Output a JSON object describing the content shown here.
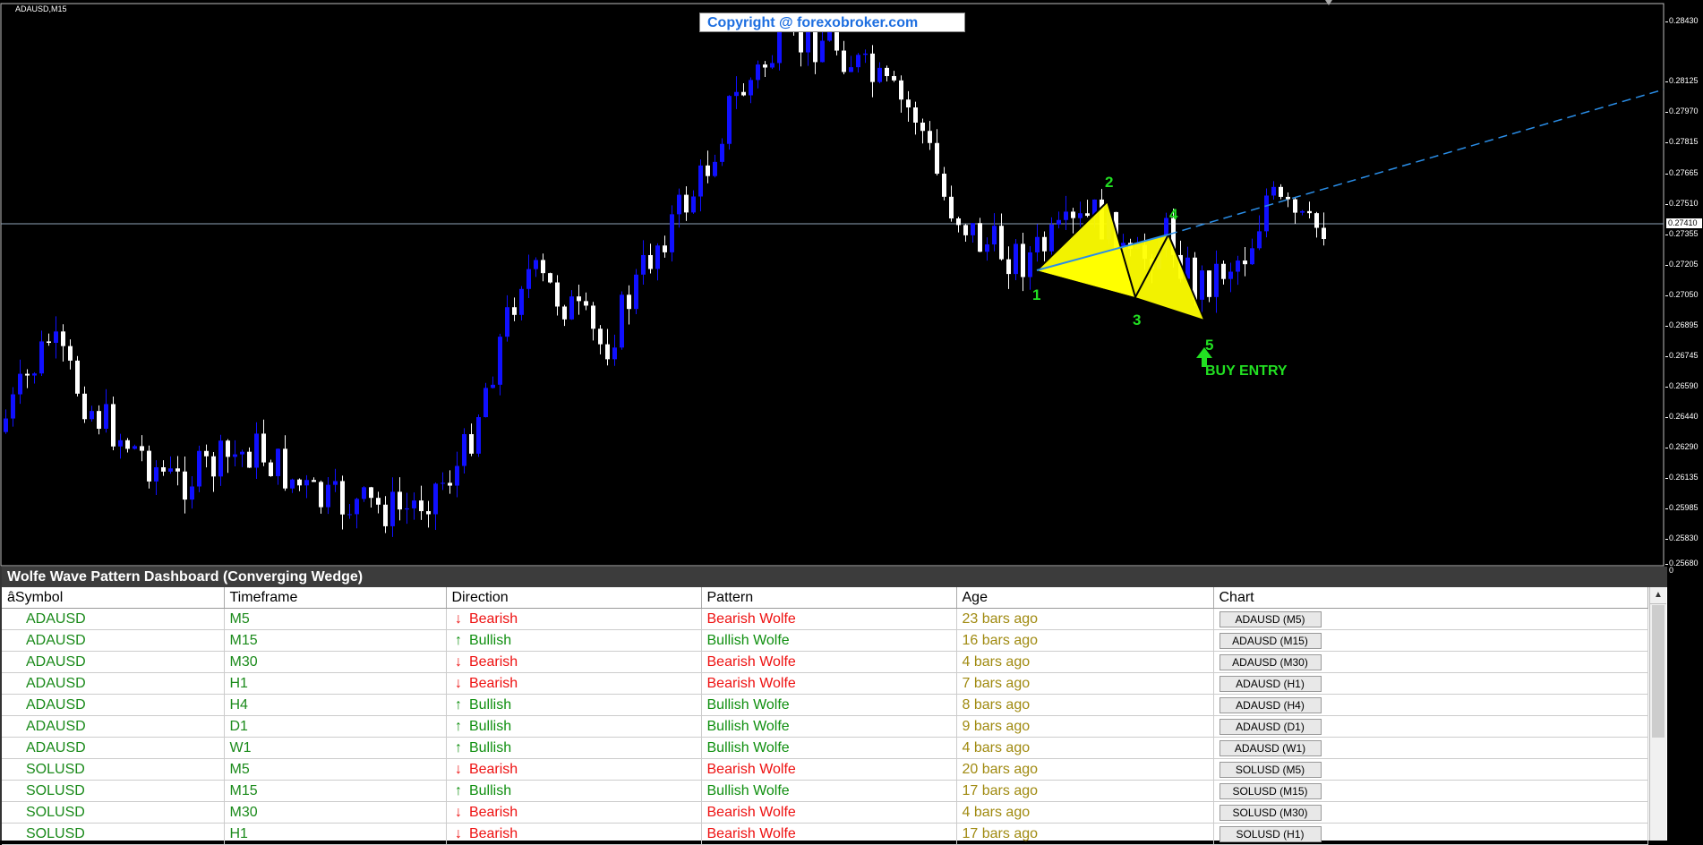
{
  "chart": {
    "symbol_label": "ADAUSD,M15",
    "copyright": "Copyright @ forexobroker.com",
    "current_price": "0.27410",
    "zero_label": "0",
    "price_ticks": [
      "0.28430",
      "0.28125",
      "0.27970",
      "0.27815",
      "0.27665",
      "0.27510",
      "0.27355",
      "0.27205",
      "0.27050",
      "0.26895",
      "0.26745",
      "0.26590",
      "0.26440",
      "0.26290",
      "0.26135",
      "0.25985",
      "0.25830",
      "0.25680"
    ],
    "wave_points": [
      "1",
      "2",
      "3",
      "4",
      "5"
    ],
    "buy_label": "BUY ENTRY",
    "colors": {
      "bull_candle": "#1010ff",
      "bear_candle": "#ffffff",
      "wedge": "#ffff00",
      "trendline": "#2a8ee8",
      "labels": "#22e022"
    }
  },
  "dashboard": {
    "title": "Wolfe Wave Pattern Dashboard (Converging Wedge)",
    "columns": [
      "âSymbol",
      "Timeframe",
      "Direction",
      "Pattern",
      "Age",
      "Chart"
    ],
    "rows": [
      {
        "symbol": "ADAUSD",
        "tf": "M5",
        "dir": "Bearish",
        "pattern": "Bearish Wolfe",
        "age": "23 bars ago",
        "chart": "ADAUSD (M5)"
      },
      {
        "symbol": "ADAUSD",
        "tf": "M15",
        "dir": "Bullish",
        "pattern": "Bullish Wolfe",
        "age": "16 bars ago",
        "chart": "ADAUSD (M15)"
      },
      {
        "symbol": "ADAUSD",
        "tf": "M30",
        "dir": "Bearish",
        "pattern": "Bearish Wolfe",
        "age": "4 bars ago",
        "chart": "ADAUSD (M30)"
      },
      {
        "symbol": "ADAUSD",
        "tf": "H1",
        "dir": "Bearish",
        "pattern": "Bearish Wolfe",
        "age": "7 bars ago",
        "chart": "ADAUSD (H1)"
      },
      {
        "symbol": "ADAUSD",
        "tf": "H4",
        "dir": "Bullish",
        "pattern": "Bullish Wolfe",
        "age": "8 bars ago",
        "chart": "ADAUSD (H4)"
      },
      {
        "symbol": "ADAUSD",
        "tf": "D1",
        "dir": "Bullish",
        "pattern": "Bullish Wolfe",
        "age": "9 bars ago",
        "chart": "ADAUSD (D1)"
      },
      {
        "symbol": "ADAUSD",
        "tf": "W1",
        "dir": "Bullish",
        "pattern": "Bullish Wolfe",
        "age": "4 bars ago",
        "chart": "ADAUSD (W1)"
      },
      {
        "symbol": "SOLUSD",
        "tf": "M5",
        "dir": "Bearish",
        "pattern": "Bearish Wolfe",
        "age": "20 bars ago",
        "chart": "SOLUSD (M5)"
      },
      {
        "symbol": "SOLUSD",
        "tf": "M15",
        "dir": "Bullish",
        "pattern": "Bullish Wolfe",
        "age": "17 bars ago",
        "chart": "SOLUSD (M15)"
      },
      {
        "symbol": "SOLUSD",
        "tf": "M30",
        "dir": "Bearish",
        "pattern": "Bearish Wolfe",
        "age": "4 bars ago",
        "chart": "SOLUSD (M30)"
      },
      {
        "symbol": "SOLUSD",
        "tf": "H1",
        "dir": "Bearish",
        "pattern": "Bearish Wolfe",
        "age": "17 bars ago",
        "chart": "SOLUSD (H1)"
      }
    ]
  }
}
